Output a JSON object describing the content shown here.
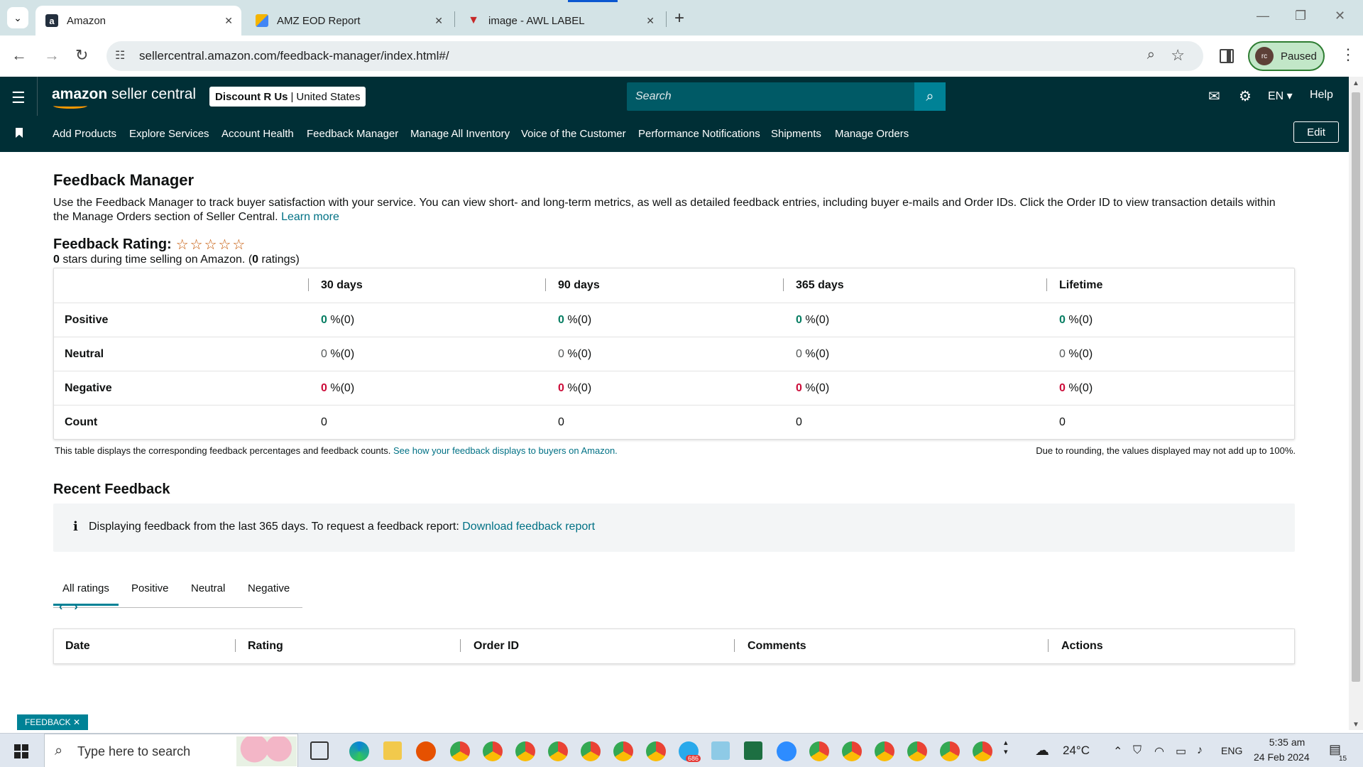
{
  "browser": {
    "tabs": [
      {
        "title": "Amazon",
        "favicon": "amazon-icon"
      },
      {
        "title": "AMZ EOD Report",
        "favicon": "sheets-icon"
      },
      {
        "title": "image - AWL LABEL",
        "favicon": "awl-icon"
      }
    ],
    "url": "sellercentral.amazon.com/feedback-manager/index.html#/",
    "profile_initials": "rc",
    "profile_status": "Paused"
  },
  "header": {
    "logo_bold": "amazon",
    "logo_rest": " seller central",
    "store_name": "Discount R Us",
    "store_region": "United States",
    "search_placeholder": "Search",
    "language": "EN",
    "help": "Help"
  },
  "nav": {
    "items": [
      "Add Products",
      "Explore Services",
      "Account Health",
      "Feedback Manager",
      "Manage All Inventory",
      "Voice of the Customer",
      "Performance Notifications",
      "Shipments",
      "Manage Orders"
    ],
    "edit": "Edit"
  },
  "page": {
    "title": "Feedback Manager",
    "intro": "Use the Feedback Manager to track buyer satisfaction with your service. You can view short- and long-term metrics, as well as detailed feedback entries, including buyer e-mails and Order IDs. Click the Order ID to view transaction details within the Manage Orders section of Seller Central.",
    "learn_more": "Learn more",
    "rating_label": "Feedback Rating:",
    "stars": "☆☆☆☆☆",
    "rating_stars": "0",
    "rating_text_1": " stars during time selling on Amazon. (",
    "rating_count": "0",
    "rating_text_2": " ratings)"
  },
  "feedback_table": {
    "columns": [
      "30 days",
      "90 days",
      "365 days",
      "Lifetime"
    ],
    "rows": [
      {
        "label": "Positive",
        "values": [
          "0",
          "0",
          "0",
          "0"
        ],
        "counts": [
          "%(0)",
          "%(0)",
          "%(0)",
          "%(0)"
        ],
        "tone": "green"
      },
      {
        "label": "Neutral",
        "values": [
          "0",
          "0",
          "0",
          "0"
        ],
        "counts": [
          "%(0)",
          "%(0)",
          "%(0)",
          "%(0)"
        ],
        "tone": "grey"
      },
      {
        "label": "Negative",
        "values": [
          "0",
          "0",
          "0",
          "0"
        ],
        "counts": [
          "%(0)",
          "%(0)",
          "%(0)",
          "%(0)"
        ],
        "tone": "red"
      },
      {
        "label": "Count",
        "values": [
          "0",
          "0",
          "0",
          "0"
        ],
        "counts": [
          "",
          "",
          "",
          ""
        ],
        "tone": "plain"
      }
    ],
    "note": "This table displays the corresponding feedback percentages and feedback counts.",
    "note_link": "See how your feedback displays to buyers on Amazon.",
    "rounding_note": "Due to rounding, the values displayed may not add up to 100%."
  },
  "recent": {
    "title": "Recent Feedback",
    "info_text": "Displaying feedback from the last 365 days. To request a feedback report:",
    "info_link": "Download feedback report",
    "tabs": [
      "All ratings",
      "Positive",
      "Neutral",
      "Negative"
    ],
    "active_tab": "All ratings",
    "columns": [
      "Date",
      "Rating",
      "Order ID",
      "Comments",
      "Actions"
    ]
  },
  "feedback_widget": "FEEDBACK",
  "taskbar": {
    "search_placeholder": "Type here to search",
    "weather": "24°C",
    "language": "ENG",
    "time": "5:35 am",
    "date": "24 Feb 2024",
    "notifications": "15",
    "telegram_badge": "686"
  }
}
